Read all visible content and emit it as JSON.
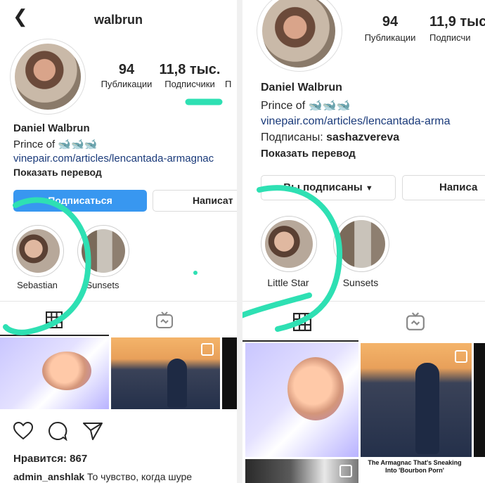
{
  "left": {
    "username": "walbrun",
    "stats": [
      {
        "value": "94",
        "label": "Публикации"
      },
      {
        "value": "11,8 тыс.",
        "label": "Подписчики"
      },
      {
        "value": "",
        "label": "П"
      }
    ],
    "name": "Daniel Walbrun",
    "bio": "Prince of",
    "bio_emoji": "🐋🐋🐋",
    "link": "vinepair.com/articles/lencantada-armagnac",
    "translate": "Показать перевод",
    "follow_button": "Подписаться",
    "message_button": "Написат",
    "highlights": [
      {
        "label": "Sebastian"
      },
      {
        "label": "Sunsets"
      }
    ],
    "likes": "Нравится: 867",
    "caption_user": "admin_anshlak",
    "caption_text": "То чувство, когда шурe"
  },
  "right": {
    "stats": [
      {
        "value": "94",
        "label": "Публикации"
      },
      {
        "value": "11,9 тыс",
        "label": "Подписчи"
      }
    ],
    "name": "Daniel Walbrun",
    "bio": "Prince of",
    "bio_emoji": "🐋🐋🐋",
    "link": "vinepair.com/articles/lencantada-arma",
    "followed_by_prefix": "Подписаны: ",
    "followed_by_user": "sashazvereva",
    "translate": "Показать перевод",
    "following_button": "Вы подписаны",
    "message_button": "Написа",
    "highlights": [
      {
        "label": "Little Star"
      },
      {
        "label": "Sunsets"
      }
    ],
    "post_caption": "The Armagnac That's Sneaking Into 'Bourbon Porn'"
  },
  "colors": {
    "accent_blue": "#3897f0",
    "annotation": "#2ee0b3",
    "link": "#1a3a7a"
  }
}
